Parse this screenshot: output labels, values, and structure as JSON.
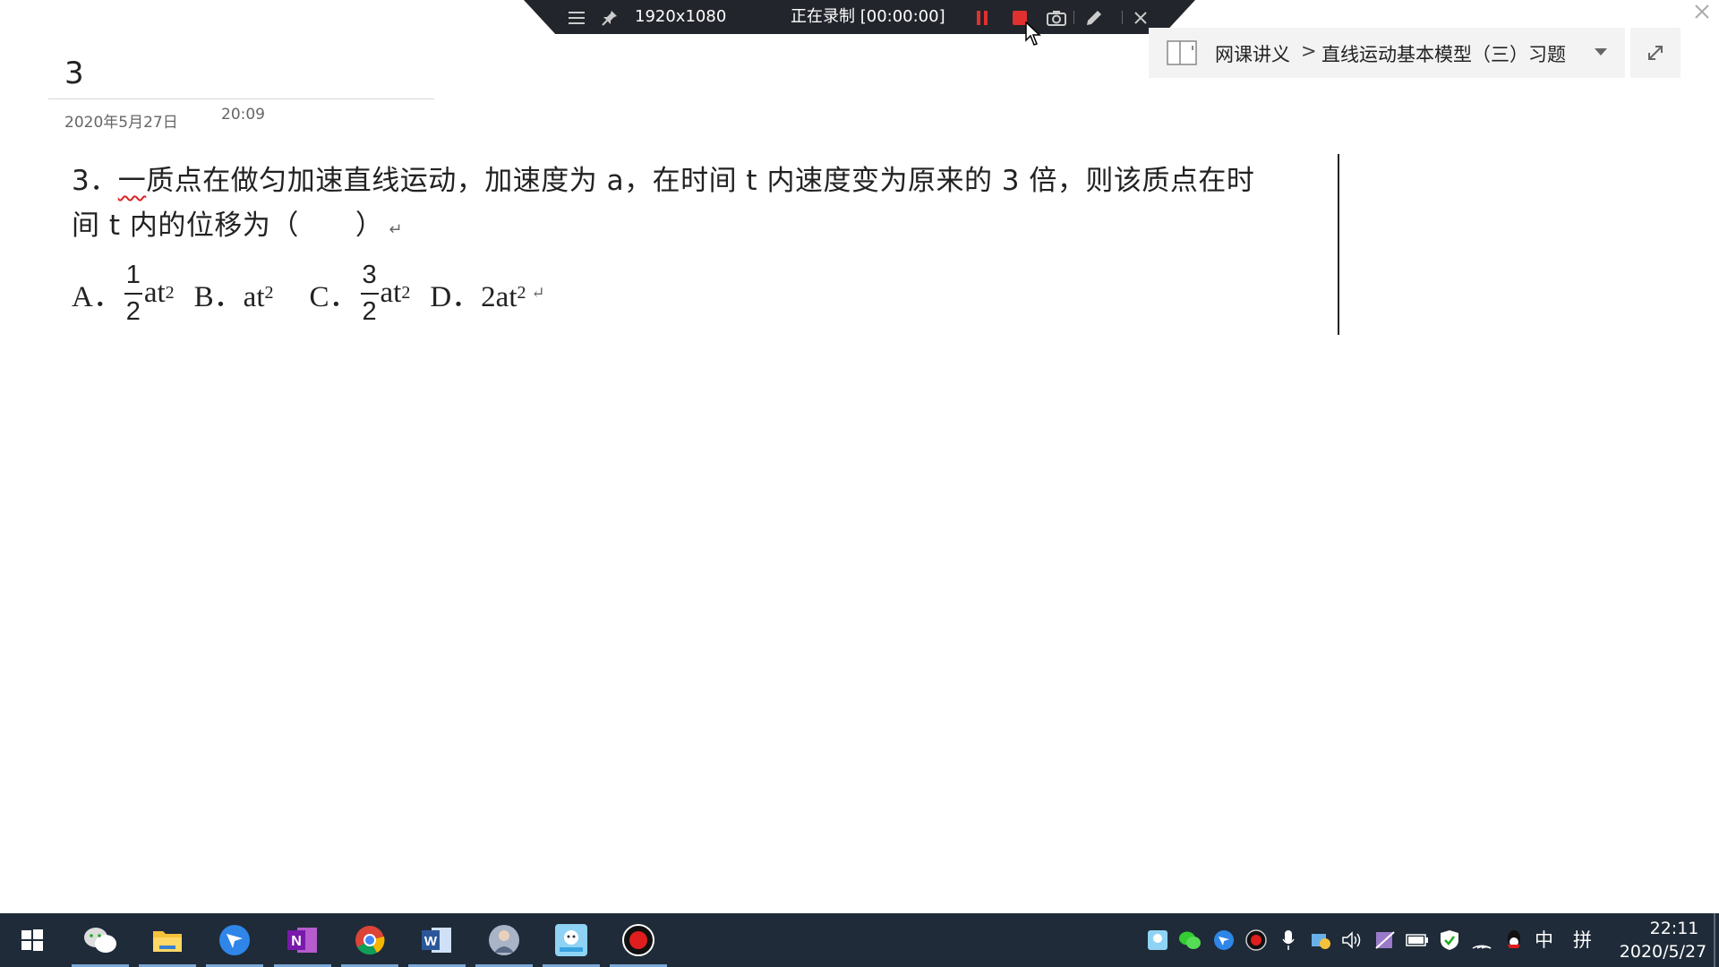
{
  "recorder": {
    "resolution": "1920x1080",
    "status": "正在录制 [00:00:00]"
  },
  "notebook_nav": {
    "path": "网课讲义",
    "separator": ">",
    "section": "直线运动基本模型（三）习题"
  },
  "page": {
    "title": "3",
    "date": "2020年5月27日",
    "time": "20:09"
  },
  "question": {
    "line1_num": "3．",
    "line1_squiggle": "一",
    "line1_rest": "质点在做匀加速直线运动，加速度为 a，在时间 t 内速度变为原来的 3 倍，则该质点在时",
    "line2": "间 t 内的位移为（　　）",
    "return_mark": "↵",
    "options": {
      "a_label": "A．",
      "a_num": "1",
      "a_den": "2",
      "a_body": "at",
      "b_label": "B．at",
      "c_label": "C．",
      "c_num": "3",
      "c_den": "2",
      "c_body": "at",
      "d_label": "D．2at",
      "sup": "2"
    }
  },
  "taskbar": {
    "apps": [
      "wechat-icon",
      "file-explorer-icon",
      "feishu-icon",
      "onenote-icon",
      "chrome-icon",
      "word-icon",
      "avatar-app-icon",
      "photo-app-icon",
      "recorder-app-icon"
    ],
    "ime_lang": "中",
    "ime_mode": "拼",
    "clock_time": "22:11",
    "clock_date": "2020/5/27"
  },
  "colors": {
    "toolbar_bg": "#22252b",
    "record_red": "#e03030",
    "taskbar_bg": "#1f2b38",
    "nav_bg": "#f3f3f3"
  }
}
